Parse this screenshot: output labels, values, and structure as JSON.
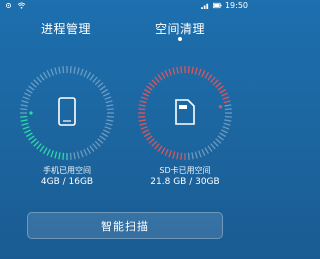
{
  "status_bar": {
    "time": "19:50",
    "icons": [
      "settings-icon",
      "wifi-icon",
      "signal-icon",
      "battery-icon"
    ]
  },
  "tabs": [
    {
      "label": "进程管理",
      "active": false
    },
    {
      "label": "空间清理",
      "active": true
    }
  ],
  "phone_storage": {
    "label": "手机已用空间",
    "value": "4GB / 16GB",
    "used_fraction": 0.25,
    "color": "#2fd9a6"
  },
  "sd_storage": {
    "label": "SD卡已用空间",
    "value": "21.8 GB / 30GB",
    "used_fraction": 0.727,
    "color": "#e0555b"
  },
  "scan_button": {
    "label": "智能扫描"
  }
}
